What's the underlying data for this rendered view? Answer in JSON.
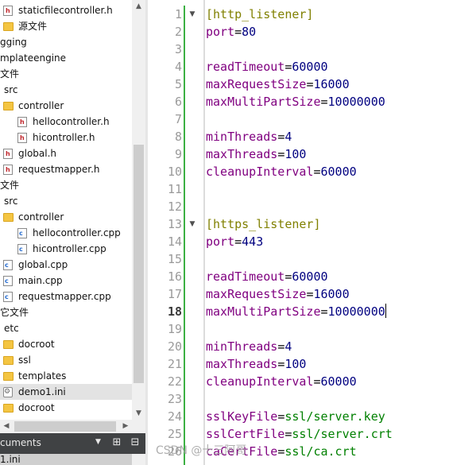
{
  "tree": {
    "rows": [
      {
        "label": "staticfilecontroller.h",
        "icon": "hfile",
        "indent": 1
      },
      {
        "label": "源文件",
        "icon": "folder",
        "indent": 0
      },
      {
        "label": "gging",
        "icon": "none",
        "indent": -1
      },
      {
        "label": "mplateengine",
        "icon": "none",
        "indent": -1
      },
      {
        "label": "文件",
        "icon": "none",
        "indent": -1
      },
      {
        "label": "src",
        "icon": "none",
        "indent": 0
      },
      {
        "label": "controller",
        "icon": "folder",
        "indent": 1
      },
      {
        "label": "hellocontroller.h",
        "icon": "hfile",
        "indent": 2
      },
      {
        "label": "hicontroller.h",
        "icon": "hfile",
        "indent": 2
      },
      {
        "label": "global.h",
        "icon": "hfile",
        "indent": 1
      },
      {
        "label": "requestmapper.h",
        "icon": "hfile",
        "indent": 1
      },
      {
        "label": "文件",
        "icon": "none",
        "indent": -1
      },
      {
        "label": "src",
        "icon": "none",
        "indent": 0
      },
      {
        "label": "controller",
        "icon": "folder",
        "indent": 1
      },
      {
        "label": "hellocontroller.cpp",
        "icon": "cppfile",
        "indent": 2
      },
      {
        "label": "hicontroller.cpp",
        "icon": "cppfile",
        "indent": 2
      },
      {
        "label": "global.cpp",
        "icon": "cppfile",
        "indent": 1
      },
      {
        "label": "main.cpp",
        "icon": "cppfile",
        "indent": 1
      },
      {
        "label": "requestmapper.cpp",
        "icon": "cppfile",
        "indent": 1
      },
      {
        "label": "它文件",
        "icon": "none",
        "indent": -1
      },
      {
        "label": "etc",
        "icon": "none",
        "indent": 0
      },
      {
        "label": "docroot",
        "icon": "folder",
        "indent": 1
      },
      {
        "label": "ssl",
        "icon": "folder",
        "indent": 1
      },
      {
        "label": "templates",
        "icon": "folder",
        "indent": 1
      },
      {
        "label": "demo1.ini",
        "icon": "inifile",
        "indent": 1,
        "selected": true
      },
      {
        "label": "docroot",
        "icon": "folder",
        "indent": 1
      }
    ]
  },
  "documents": {
    "title": "cuments",
    "open_file": "1.ini"
  },
  "editor": {
    "current_line": 18,
    "lines": [
      {
        "n": "1",
        "fold": true,
        "parts": [
          {
            "t": "[http_listener]",
            "c": "sec"
          }
        ]
      },
      {
        "n": "2",
        "parts": [
          {
            "t": "port",
            "c": "k"
          },
          {
            "t": "=",
            "c": "eq"
          },
          {
            "t": "80",
            "c": "num"
          }
        ]
      },
      {
        "n": "3",
        "parts": []
      },
      {
        "n": "4",
        "parts": [
          {
            "t": "readTimeout",
            "c": "k"
          },
          {
            "t": "=",
            "c": "eq"
          },
          {
            "t": "60000",
            "c": "num"
          }
        ]
      },
      {
        "n": "5",
        "parts": [
          {
            "t": "maxRequestSize",
            "c": "k"
          },
          {
            "t": "=",
            "c": "eq"
          },
          {
            "t": "16000",
            "c": "num"
          }
        ]
      },
      {
        "n": "6",
        "parts": [
          {
            "t": "maxMultiPartSize",
            "c": "k"
          },
          {
            "t": "=",
            "c": "eq"
          },
          {
            "t": "10000000",
            "c": "num"
          }
        ]
      },
      {
        "n": "7",
        "parts": []
      },
      {
        "n": "8",
        "parts": [
          {
            "t": "minThreads",
            "c": "k"
          },
          {
            "t": "=",
            "c": "eq"
          },
          {
            "t": "4",
            "c": "num"
          }
        ]
      },
      {
        "n": "9",
        "parts": [
          {
            "t": "maxThreads",
            "c": "k"
          },
          {
            "t": "=",
            "c": "eq"
          },
          {
            "t": "100",
            "c": "num"
          }
        ]
      },
      {
        "n": "10",
        "parts": [
          {
            "t": "cleanupInterval",
            "c": "k"
          },
          {
            "t": "=",
            "c": "eq"
          },
          {
            "t": "60000",
            "c": "num"
          }
        ]
      },
      {
        "n": "11",
        "parts": []
      },
      {
        "n": "12",
        "parts": []
      },
      {
        "n": "13",
        "fold": true,
        "parts": [
          {
            "t": "[https_listener]",
            "c": "sec"
          }
        ]
      },
      {
        "n": "14",
        "parts": [
          {
            "t": "port",
            "c": "k"
          },
          {
            "t": "=",
            "c": "eq"
          },
          {
            "t": "443",
            "c": "num"
          }
        ]
      },
      {
        "n": "15",
        "parts": []
      },
      {
        "n": "16",
        "parts": [
          {
            "t": "readTimeout",
            "c": "k"
          },
          {
            "t": "=",
            "c": "eq"
          },
          {
            "t": "60000",
            "c": "num"
          }
        ]
      },
      {
        "n": "17",
        "parts": [
          {
            "t": "maxRequestSize",
            "c": "k"
          },
          {
            "t": "=",
            "c": "eq"
          },
          {
            "t": "16000",
            "c": "num"
          }
        ]
      },
      {
        "n": "18",
        "parts": [
          {
            "t": "maxMultiPartSize",
            "c": "k"
          },
          {
            "t": "=",
            "c": "eq"
          },
          {
            "t": "10000000",
            "c": "num"
          }
        ],
        "cursor": true
      },
      {
        "n": "19",
        "parts": []
      },
      {
        "n": "20",
        "parts": [
          {
            "t": "minThreads",
            "c": "k"
          },
          {
            "t": "=",
            "c": "eq"
          },
          {
            "t": "4",
            "c": "num"
          }
        ]
      },
      {
        "n": "21",
        "parts": [
          {
            "t": "maxThreads",
            "c": "k"
          },
          {
            "t": "=",
            "c": "eq"
          },
          {
            "t": "100",
            "c": "num"
          }
        ]
      },
      {
        "n": "22",
        "parts": [
          {
            "t": "cleanupInterval",
            "c": "k"
          },
          {
            "t": "=",
            "c": "eq"
          },
          {
            "t": "60000",
            "c": "num"
          }
        ]
      },
      {
        "n": "23",
        "parts": []
      },
      {
        "n": "24",
        "parts": [
          {
            "t": "sslKeyFile",
            "c": "k"
          },
          {
            "t": "=",
            "c": "eq"
          },
          {
            "t": "ssl/server.key",
            "c": "str"
          }
        ]
      },
      {
        "n": "25",
        "parts": [
          {
            "t": "sslCertFile",
            "c": "k"
          },
          {
            "t": "=",
            "c": "eq"
          },
          {
            "t": "ssl/server.crt",
            "c": "str"
          }
        ]
      },
      {
        "n": "26",
        "parts": [
          {
            "t": "caCertFile",
            "c": "k"
          },
          {
            "t": "=",
            "c": "eq"
          },
          {
            "t": "ssl/ca.crt",
            "c": "str"
          }
        ]
      }
    ]
  },
  "watermark": "CSDN @十三阿哥",
  "colors": {
    "section": "#808000",
    "key": "#800080",
    "number": "#000080",
    "string": "#008000",
    "change_bar": "#3cb043"
  }
}
